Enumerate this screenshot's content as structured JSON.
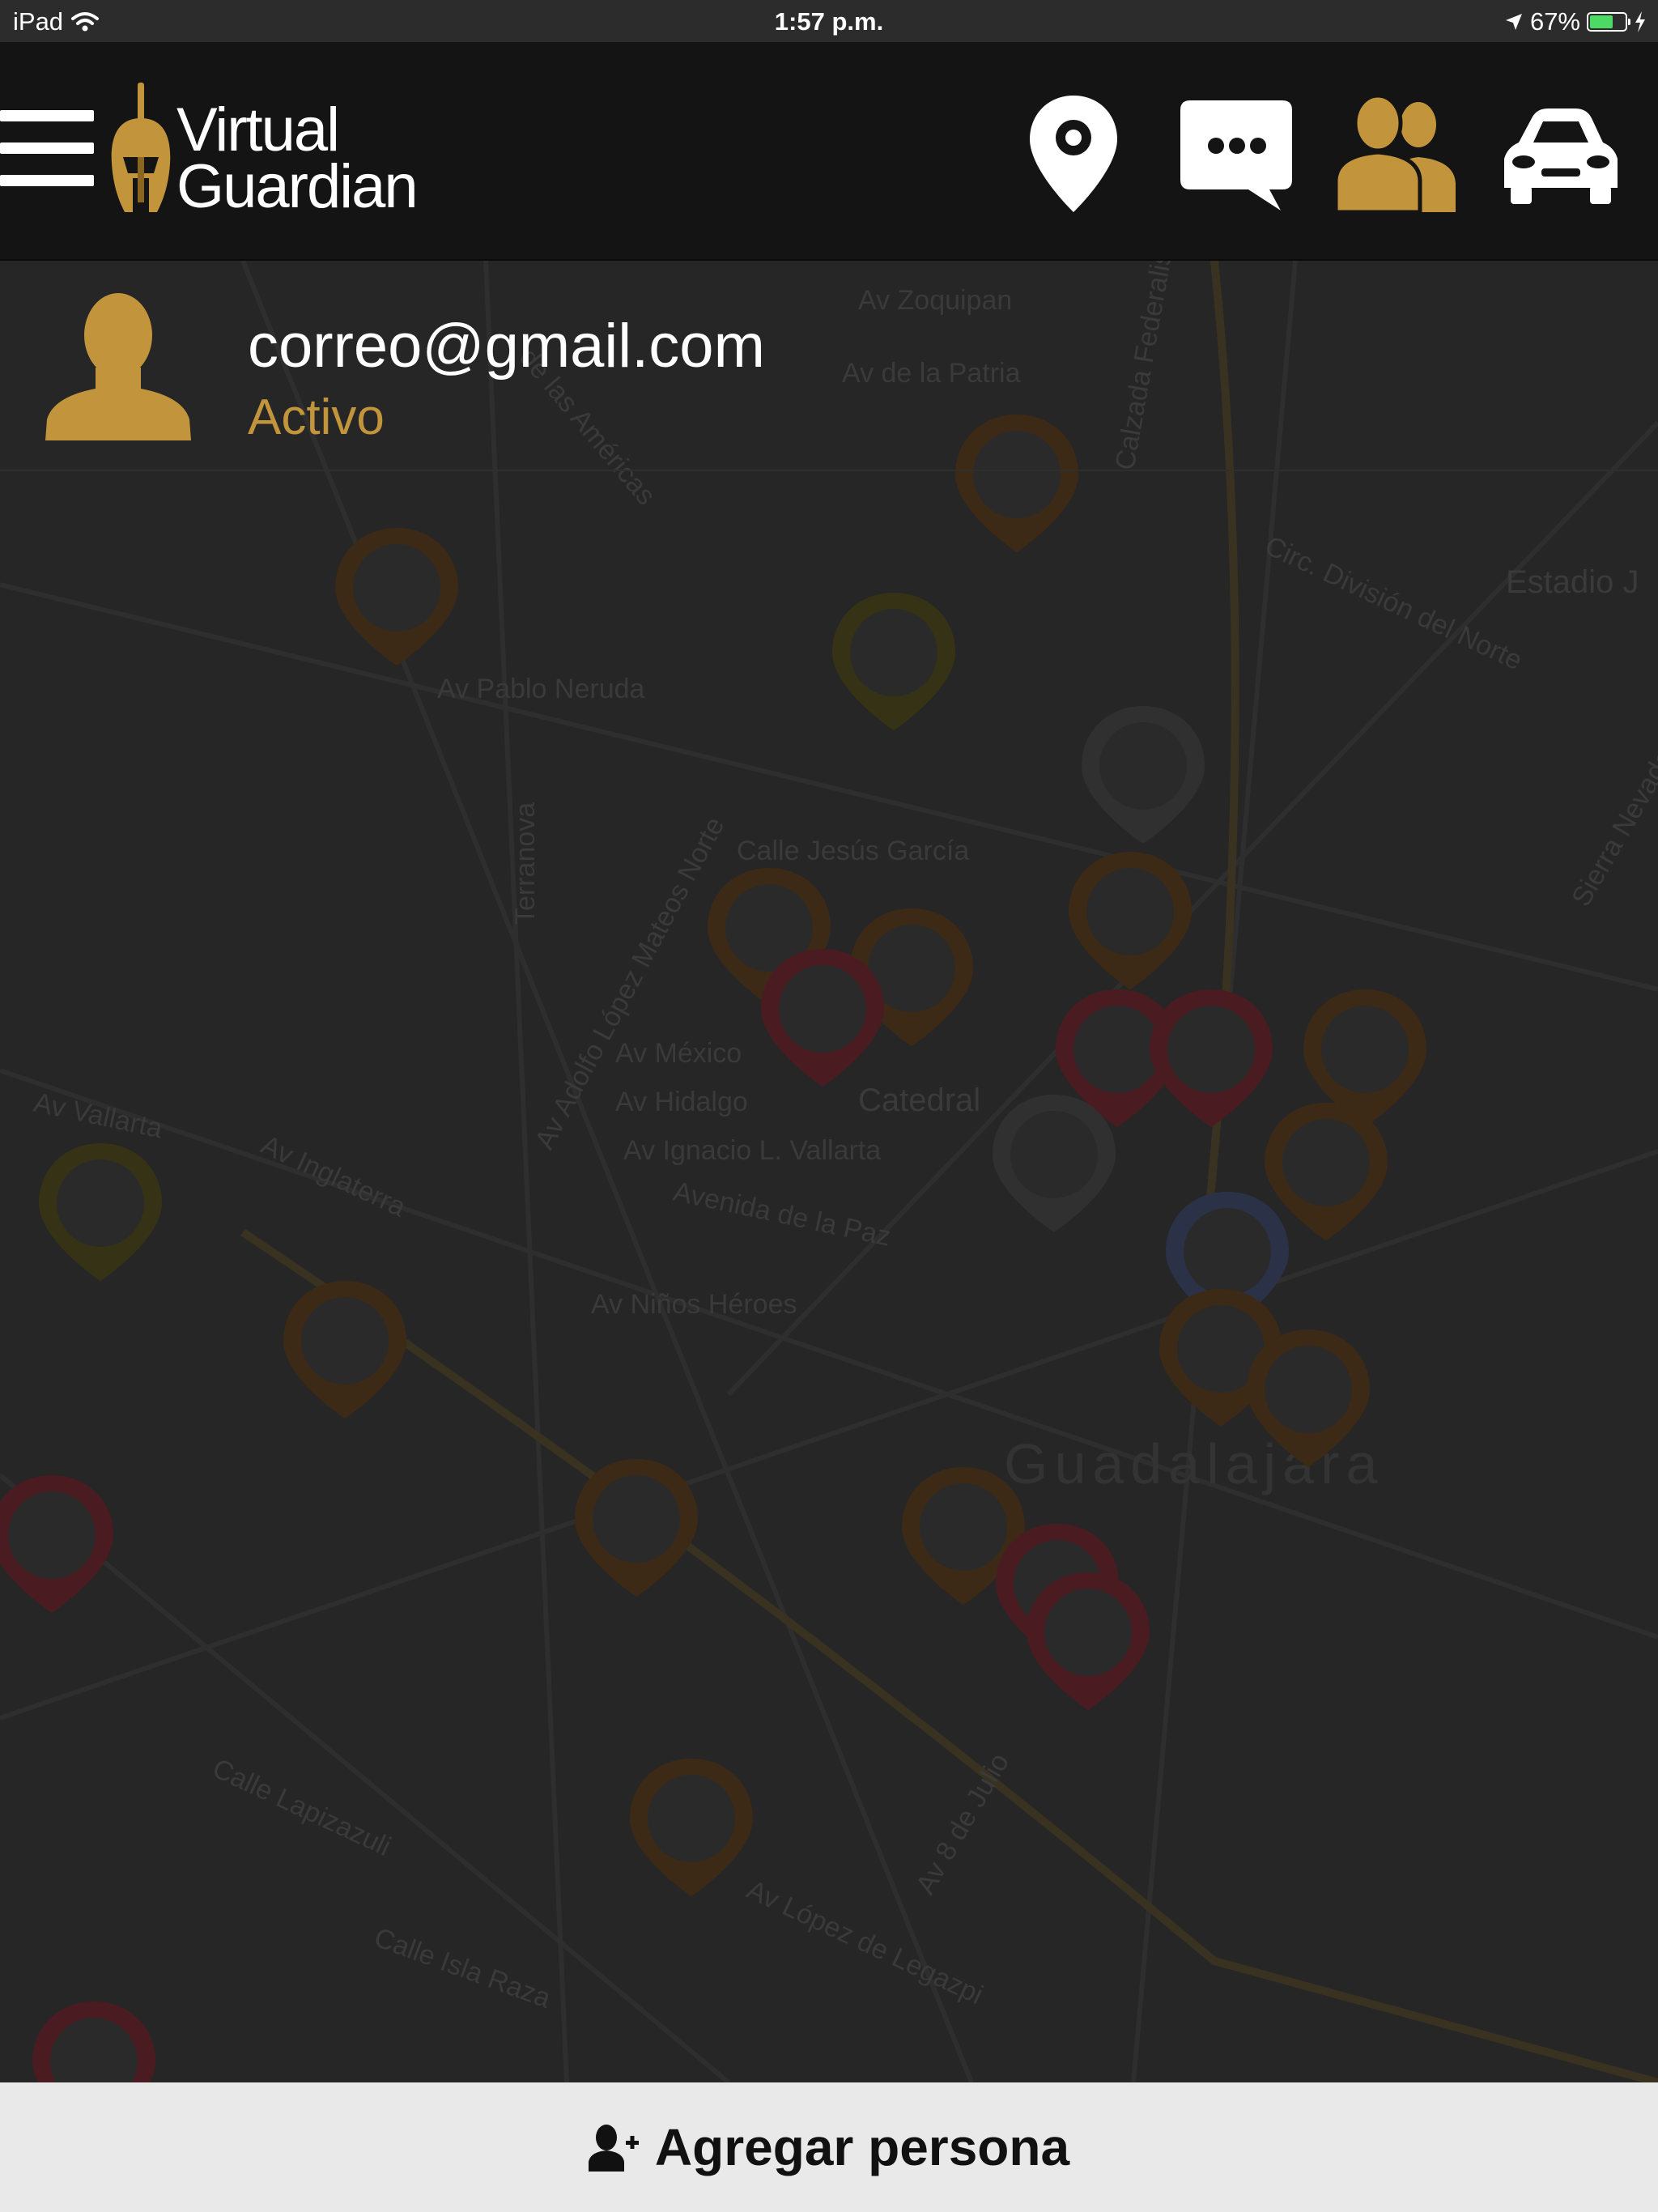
{
  "status_bar": {
    "device": "iPad",
    "time": "1:57 p.m.",
    "battery": "67%",
    "battery_level": 0.67
  },
  "header": {
    "logo_line1": "Virtual",
    "logo_line2": "Guardian",
    "icons": [
      "location-pin-icon",
      "chat-bubble-icon",
      "contacts-icon",
      "car-icon"
    ],
    "active_icon": "contacts-icon"
  },
  "contact": {
    "email": "correo@gmail.com",
    "status": "Activo"
  },
  "map_labels": [
    "Av Zoquipan",
    "Av de la Patria",
    "Calzada Federalismo",
    "de las Américas",
    "Av Pablo Neruda",
    "Circ. División del Norte",
    "Estadio J",
    "Calle Jesús García",
    "Terranova",
    "Av Adolfo López Mateos Norte",
    "Av México",
    "Av Hidalgo",
    "Catedral",
    "Av Ignacio L. Vallarta",
    "Avenida de la Paz",
    "Av Vallarta",
    "Av Inglaterra",
    "Av Niños Héroes",
    "Guadalajara",
    "Calle Lapizazuli",
    "Calle Isla Raza",
    "Av López de Legazpi",
    "Av 8 de Julio",
    "Sierra Nevada"
  ],
  "footer": {
    "add_label": "Agregar persona"
  },
  "colors": {
    "accent": "#c2953c",
    "header_bg": "#141414",
    "footer_bg": "#e9e9e9"
  }
}
